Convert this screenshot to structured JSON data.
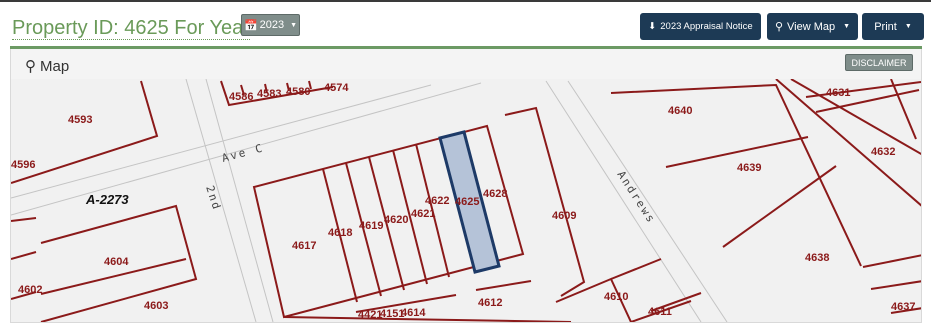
{
  "header": {
    "title": "Property ID: 4625 For Year",
    "year": "2023",
    "appraisal_notice": "2023 Appraisal Notice",
    "view_map": "View Map",
    "print": "Print"
  },
  "panel": {
    "title": "Map",
    "disclaimer": "DISCLAIMER"
  },
  "map": {
    "streets": [
      "Ave C",
      "2nd",
      "Andrews"
    ],
    "subdivision": "A-2273",
    "selected_parcel": "4625",
    "parcels": [
      "4586",
      "4583",
      "4580",
      "4574",
      "4593",
      "4596",
      "4640",
      "4631",
      "4632",
      "4639",
      "4622",
      "4625",
      "4628",
      "4621",
      "4620",
      "4619",
      "4618",
      "4617",
      "4609",
      "4604",
      "4638",
      "4602",
      "4603",
      "4612",
      "4610",
      "4611",
      "4421",
      "4151",
      "4614",
      "4637"
    ],
    "colors": {
      "parcel_line": "#8b1a1a",
      "selected_fill": "#b5c3d8",
      "selected_stroke": "#1d3a67",
      "map_background": "#f1f1f1",
      "road": "#c4c4c4"
    }
  }
}
